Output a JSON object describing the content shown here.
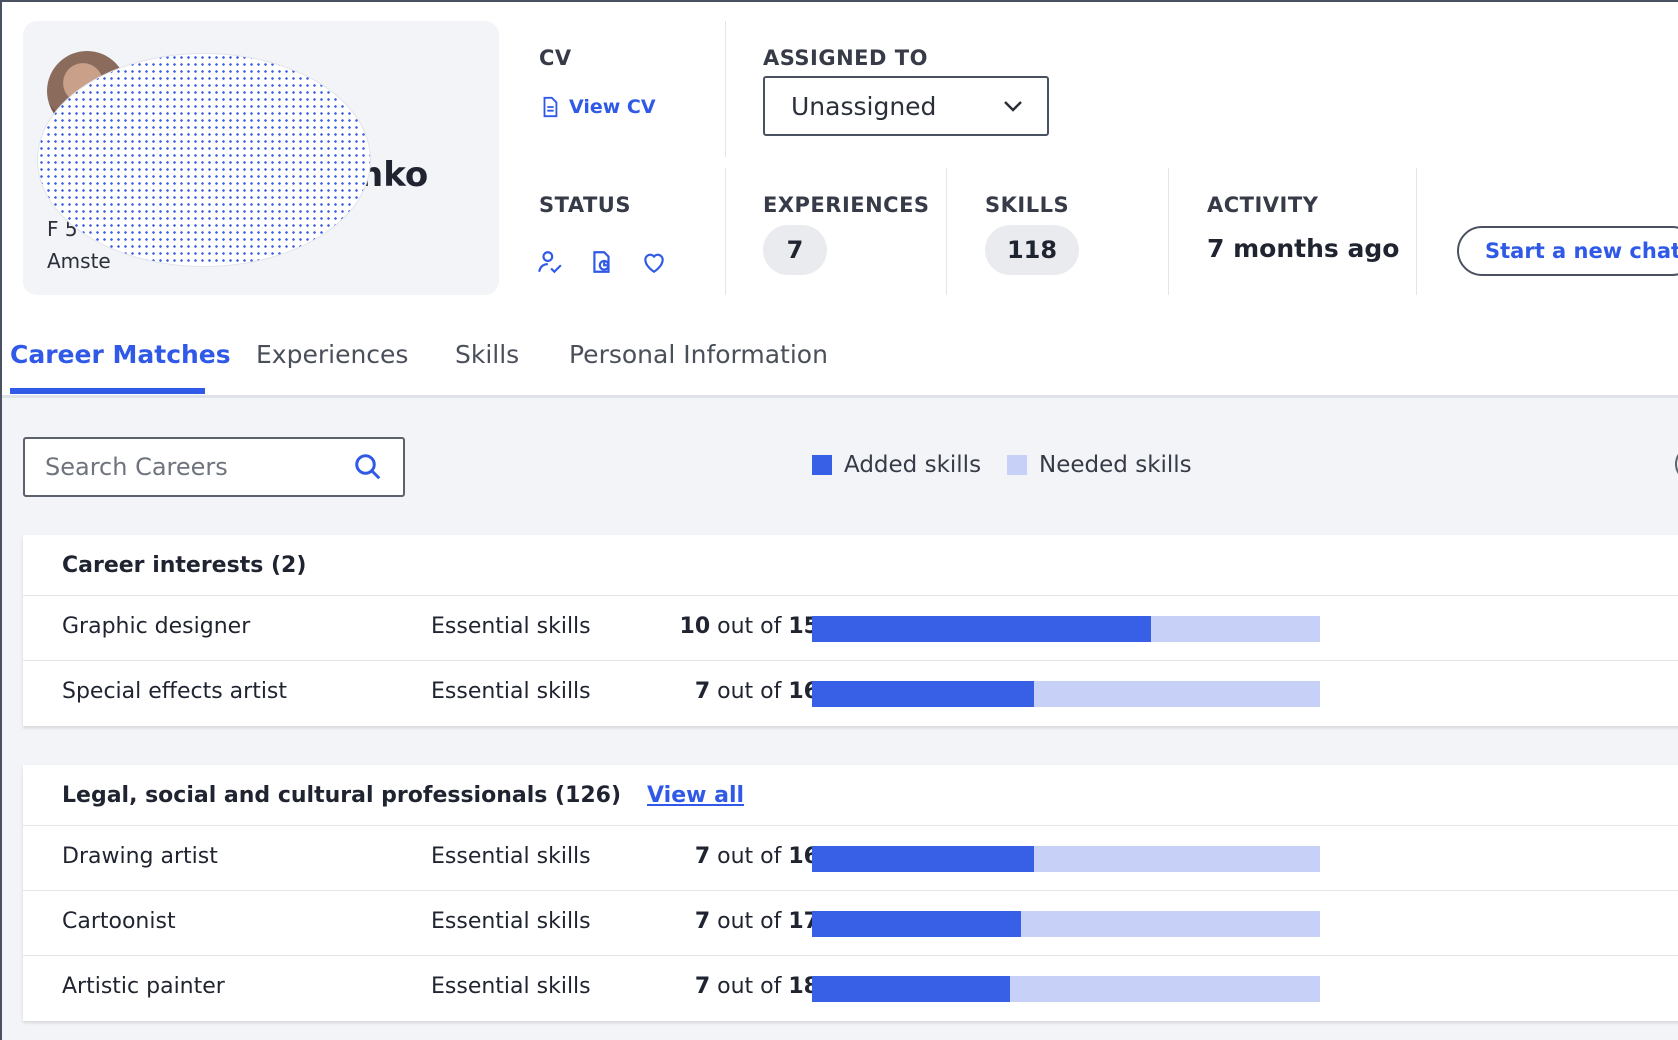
{
  "profile": {
    "name": "nko",
    "meta": "F                       5-10",
    "location": "Amste"
  },
  "cv": {
    "label": "CV",
    "link_label": "View CV"
  },
  "assigned_to": {
    "label": "ASSIGNED TO",
    "selected": "Unassigned"
  },
  "status": {
    "label": "STATUS",
    "icons": [
      "person-check-icon",
      "document-refresh-icon",
      "heart-icon"
    ]
  },
  "experiences": {
    "label": "EXPERIENCES",
    "count": "7"
  },
  "skills": {
    "label": "SKILLS",
    "count": "118"
  },
  "activity": {
    "label": "ACTIVITY",
    "value": "7 months ago"
  },
  "chat": {
    "label": "Start a new chat"
  },
  "tabs": [
    {
      "label": "Career Matches",
      "active": true
    },
    {
      "label": "Experiences",
      "active": false
    },
    {
      "label": "Skills",
      "active": false
    },
    {
      "label": "Personal Information",
      "active": false
    }
  ],
  "search": {
    "placeholder": "Search Careers"
  },
  "legend": {
    "added": "Added skills",
    "needed": "Needed skills"
  },
  "colors": {
    "accent": "#2f59e6",
    "added": "#3760e6",
    "needed": "#c7d1f7"
  },
  "groups": [
    {
      "title": "Career interests (2)",
      "view_all": "",
      "rows": [
        {
          "career": "Graphic designer",
          "type": "Essential skills",
          "have": "10",
          "of_text": "out of",
          "total": "15",
          "fraction": 0.667
        },
        {
          "career": "Special effects artist",
          "type": "Essential skills",
          "have": "7",
          "of_text": "out of",
          "total": "16",
          "fraction": 0.4375
        }
      ]
    },
    {
      "title": "Legal, social and cultural professionals (126)",
      "view_all": "View all",
      "rows": [
        {
          "career": "Drawing artist",
          "type": "Essential skills",
          "have": "7",
          "of_text": "out of",
          "total": "16",
          "fraction": 0.4375
        },
        {
          "career": "Cartoonist",
          "type": "Essential skills",
          "have": "7",
          "of_text": "out of",
          "total": "17",
          "fraction": 0.412
        },
        {
          "career": "Artistic painter",
          "type": "Essential skills",
          "have": "7",
          "of_text": "out of",
          "total": "18",
          "fraction": 0.389
        }
      ]
    }
  ]
}
